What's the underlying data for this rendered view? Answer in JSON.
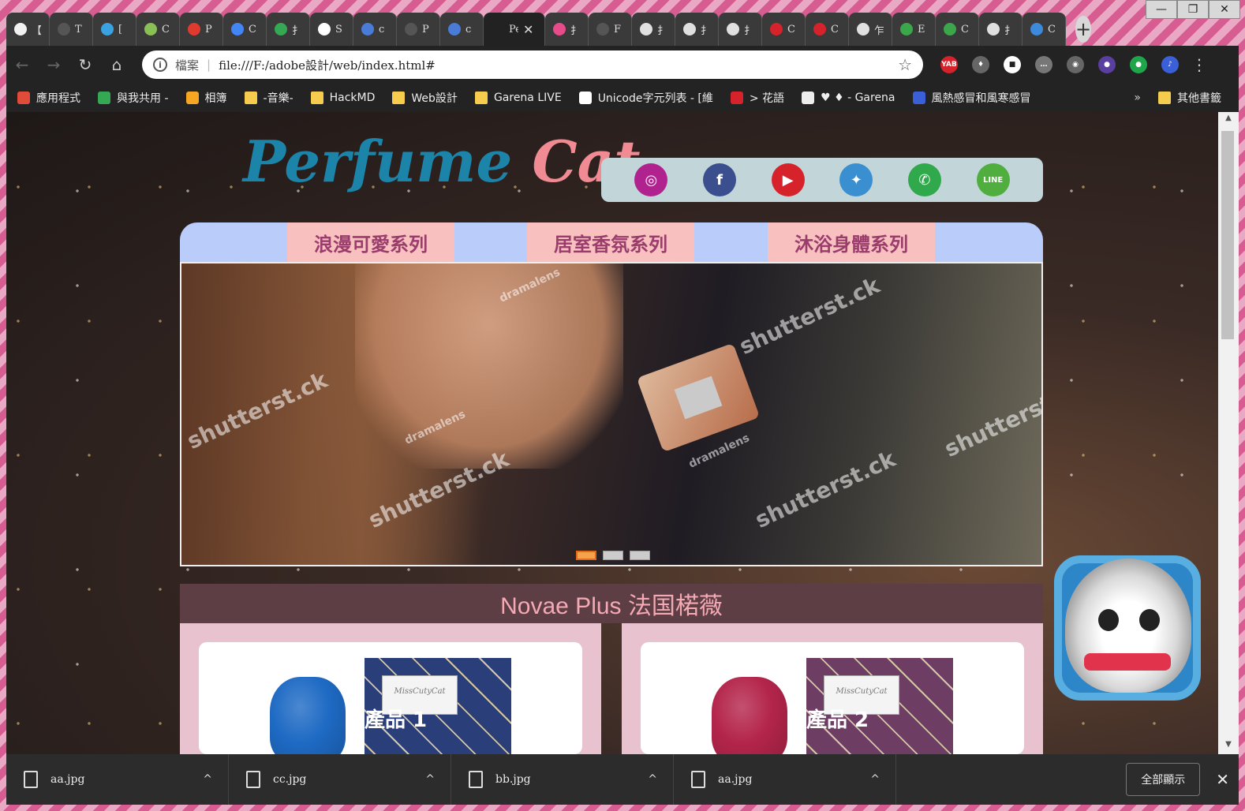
{
  "window": {
    "controls": [
      "—",
      "❐",
      "✕"
    ]
  },
  "tabs": [
    {
      "label": "【",
      "color": "#f2f2f2"
    },
    {
      "label": "T",
      "color": "#555555"
    },
    {
      "label": "[",
      "color": "#3aa2e0"
    },
    {
      "label": "C",
      "color": "#88c055"
    },
    {
      "label": "P",
      "color": "#e03a2f"
    },
    {
      "label": "C",
      "color": "#4285f4"
    },
    {
      "label": "扌",
      "color": "#34a853"
    },
    {
      "label": "S",
      "color": "#ffffff"
    },
    {
      "label": "c",
      "color": "#4a7bd6"
    },
    {
      "label": "P",
      "color": "#555555"
    },
    {
      "label": "c",
      "color": "#4a7bd6"
    },
    {
      "label": "Pe",
      "color": "#222222",
      "active": true
    },
    {
      "label": "扌",
      "color": "#e84b8a"
    },
    {
      "label": "F",
      "color": "#555555"
    },
    {
      "label": "扌",
      "color": "#e0e0e0"
    },
    {
      "label": "扌",
      "color": "#e0e0e0"
    },
    {
      "label": "扌",
      "color": "#e0e0e0"
    },
    {
      "label": "C",
      "color": "#d6232b"
    },
    {
      "label": "C",
      "color": "#d6232b"
    },
    {
      "label": "乍",
      "color": "#e0e0e0"
    },
    {
      "label": "E",
      "color": "#3ca64a"
    },
    {
      "label": "C",
      "color": "#3ca64a"
    },
    {
      "label": "扌",
      "color": "#e0e0e0"
    },
    {
      "label": "C",
      "color": "#3c8ad9"
    }
  ],
  "toolbar": {
    "back": "←",
    "forward": "→",
    "reload": "↻",
    "home": "⌂",
    "info_icon": "i",
    "scheme": "檔案",
    "url": "file:///F:/adobe設計/web/index.html#",
    "star": "☆",
    "extensions": [
      {
        "label": "YAB",
        "color": "#d6232b"
      },
      {
        "label": "♦",
        "color": "#666666"
      },
      {
        "label": "■",
        "color": "#ffffff"
      },
      {
        "label": "…",
        "color": "#777777"
      },
      {
        "label": "◉",
        "color": "#666666"
      },
      {
        "label": "●",
        "color": "#5a3fa0"
      },
      {
        "label": "●",
        "color": "#1fa64a"
      }
    ],
    "menu": "⋮"
  },
  "bookmarks": {
    "items": [
      {
        "label": "應用程式",
        "icon": "apps-grid",
        "color": "#e04b3a"
      },
      {
        "label": "與我共用 -",
        "icon": "drive",
        "color": "#34a853"
      },
      {
        "label": "相簿",
        "icon": "photos",
        "color": "#f5a623"
      },
      {
        "label": "-音樂-",
        "icon": "folder",
        "color": "#f5cc4d"
      },
      {
        "label": "HackMD",
        "icon": "folder",
        "color": "#f5cc4d"
      },
      {
        "label": "Web設計",
        "icon": "folder",
        "color": "#f5cc4d"
      },
      {
        "label": "Garena LIVE",
        "icon": "folder",
        "color": "#f5cc4d"
      },
      {
        "label": "Unicode字元列表 - [維",
        "icon": "wikipedia",
        "color": "#ffffff"
      },
      {
        "label": "> 花語",
        "icon": "site",
        "color": "#d6232b"
      },
      {
        "label": "♥ ♦ - Garena",
        "icon": "heart",
        "color": "#eeeeee"
      },
      {
        "label": "風熱感冒和風寒感冒",
        "icon": "site",
        "color": "#3a5fd6"
      }
    ],
    "more": "»",
    "other": "其他書籤"
  },
  "site": {
    "logo_part1": "Perfume",
    "logo_part2": "Cat",
    "social": [
      {
        "name": "instagram",
        "glyph": "◎",
        "color": "#b0238f"
      },
      {
        "name": "facebook",
        "glyph": "f",
        "color": "#3b4f8f"
      },
      {
        "name": "youtube",
        "glyph": "▶",
        "color": "#d6232b"
      },
      {
        "name": "twitter",
        "glyph": "✦",
        "color": "#3a8fd0"
      },
      {
        "name": "whatsapp",
        "glyph": "✆",
        "color": "#2fa94b"
      },
      {
        "name": "line",
        "glyph": "LINE",
        "color": "#4fae3d"
      }
    ],
    "menu": [
      "浪漫可愛系列",
      "居室香氛系列",
      "沐浴身體系列"
    ],
    "slider": {
      "watermarks": [
        "shutterst.ck",
        "shutterst.ck",
        "shutterst.ck",
        "shutterst.ck",
        "shutterst.ck",
        "dramalens",
        "dramalens",
        "dramalens"
      ],
      "active_dot": 1,
      "dot_count": 3
    },
    "section_title": "Novae Plus 法国楉薇",
    "products": [
      {
        "label": "產品 1",
        "bottle_color": "#1e6ac4",
        "box_color": "#2a3f7a",
        "tag": "MissCutyCat"
      },
      {
        "label": "產品 2",
        "bottle_color": "#b4254b",
        "box_color": "#6d3d64",
        "tag": "MissCutyCat"
      }
    ]
  },
  "downloads": {
    "items": [
      {
        "name": "aa.jpg"
      },
      {
        "name": "cc.jpg"
      },
      {
        "name": "bb.jpg"
      },
      {
        "name": "aa.jpg"
      }
    ],
    "caret": "^",
    "show_all": "全部顯示",
    "close": "✕"
  }
}
